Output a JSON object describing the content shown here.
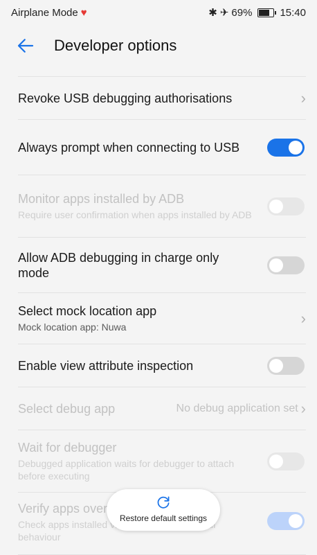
{
  "status_bar": {
    "mode": "Airplane Mode",
    "battery": "69%",
    "time": "15:40",
    "bluetooth_icon": "bluetooth-icon",
    "airplane_icon": "airplane-icon"
  },
  "app_bar": {
    "title": "Developer options",
    "back_icon": "arrow-left-icon"
  },
  "items": [
    {
      "label": "Revoke USB debugging authorisations",
      "control": "chevron"
    },
    {
      "label": "Always prompt when connecting to USB",
      "control": "toggle",
      "on": true
    },
    {
      "label": "Monitor apps installed by ADB",
      "sub": "Require user confirmation when apps installed by ADB",
      "control": "toggle",
      "on": false,
      "disabled": true
    },
    {
      "label": "Allow ADB debugging in charge only mode",
      "control": "toggle",
      "on": false
    },
    {
      "label": "Select mock location app",
      "sub": "Mock location app: Nuwa",
      "control": "chevron"
    },
    {
      "label": "Enable view attribute inspection",
      "control": "toggle",
      "on": false
    },
    {
      "label": "Select debug app",
      "value": "No debug application set",
      "control": "chevron",
      "disabled": true
    },
    {
      "label": "Wait for debugger",
      "sub": "Debugged application waits for debugger to attach before executing",
      "control": "toggle",
      "on": false,
      "disabled": true
    },
    {
      "label": "Verify apps over USB",
      "sub": "Check apps installed via ADB/ADT for harmful behaviour",
      "control": "toggle",
      "on": true,
      "disabled": true
    }
  ],
  "restore": {
    "label": "Restore default settings",
    "icon": "refresh-icon"
  },
  "colors": {
    "accent": "#1a73e8"
  }
}
